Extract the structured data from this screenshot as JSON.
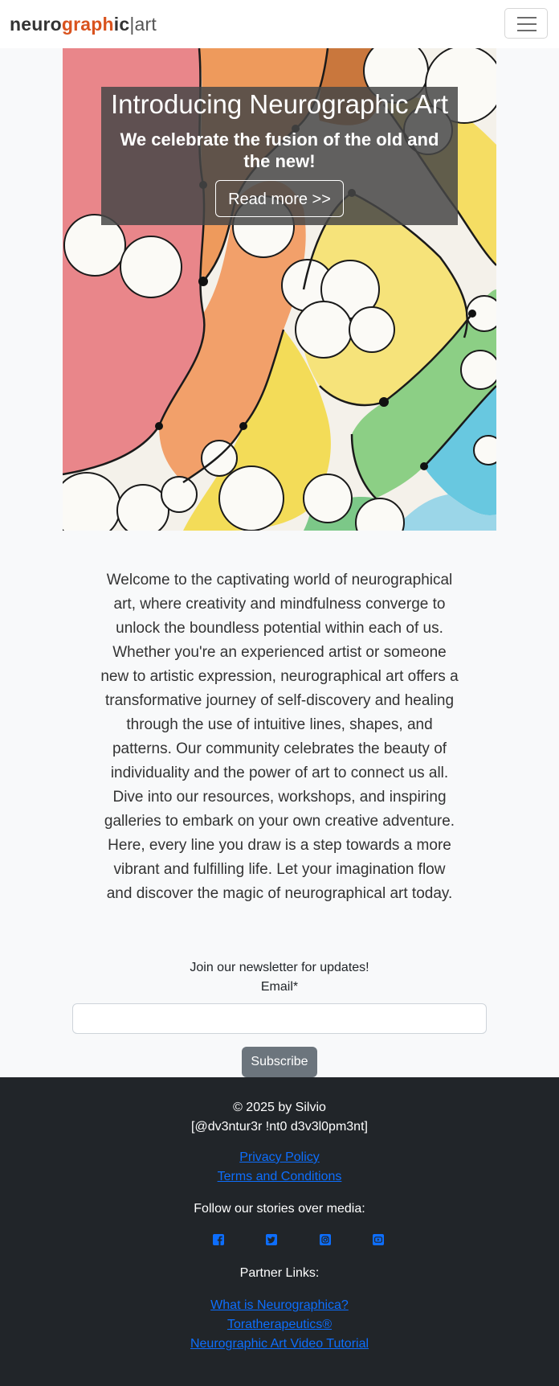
{
  "navbar": {
    "brand_part1": "neuro",
    "brand_part2": "graph",
    "brand_part3": "ic",
    "brand_part4": "|art",
    "menu_icon": "hamburger-menu-icon"
  },
  "hero": {
    "title": "Introducing Neurographic Art",
    "subtitle": "We celebrate the fusion of the old and the new!",
    "button_label": "Read more >>"
  },
  "intro": {
    "text": "Welcome to the captivating world of neurographical art, where creativity and mindfulness converge to unlock the boundless potential within each of us. Whether you're an experienced artist or someone new to artistic expression, neurographical art offers a transformative journey of self-discovery and healing through the use of intuitive lines, shapes, and patterns. Our community celebrates the beauty of individuality and the power of art to connect us all. Dive into our resources, workshops, and inspiring galleries to embark on your own creative adventure. Here, every line you draw is a step towards a more vibrant and fulfilling life. Let your imagination flow and discover the magic of neurographical art today."
  },
  "newsletter": {
    "lead": "Join our newsletter for updates!",
    "email_label": "Email*",
    "email_value": "",
    "subscribe_label": "Subscribe"
  },
  "footer": {
    "copyright": "© 2025 by Silvio",
    "tagline": "[@dv3ntur3r !nt0 d3v3l0pm3nt]",
    "privacy": "Privacy Policy",
    "terms": "Terms and Conditions",
    "follow": "Follow our stories over media:",
    "social_icons": [
      "facebook-icon",
      "twitter-icon",
      "instagram-icon",
      "youtube-icon"
    ],
    "partner_heading": "Partner Links:",
    "partner_links": [
      "What is Neurographica?",
      "Toratherapeutics®",
      "Neurographic Art Video Tutorial"
    ]
  },
  "colors": {
    "brand_accent": "#d9531e",
    "link": "#0d6efd",
    "footer_bg": "#212529",
    "button_secondary": "#6c757d"
  }
}
